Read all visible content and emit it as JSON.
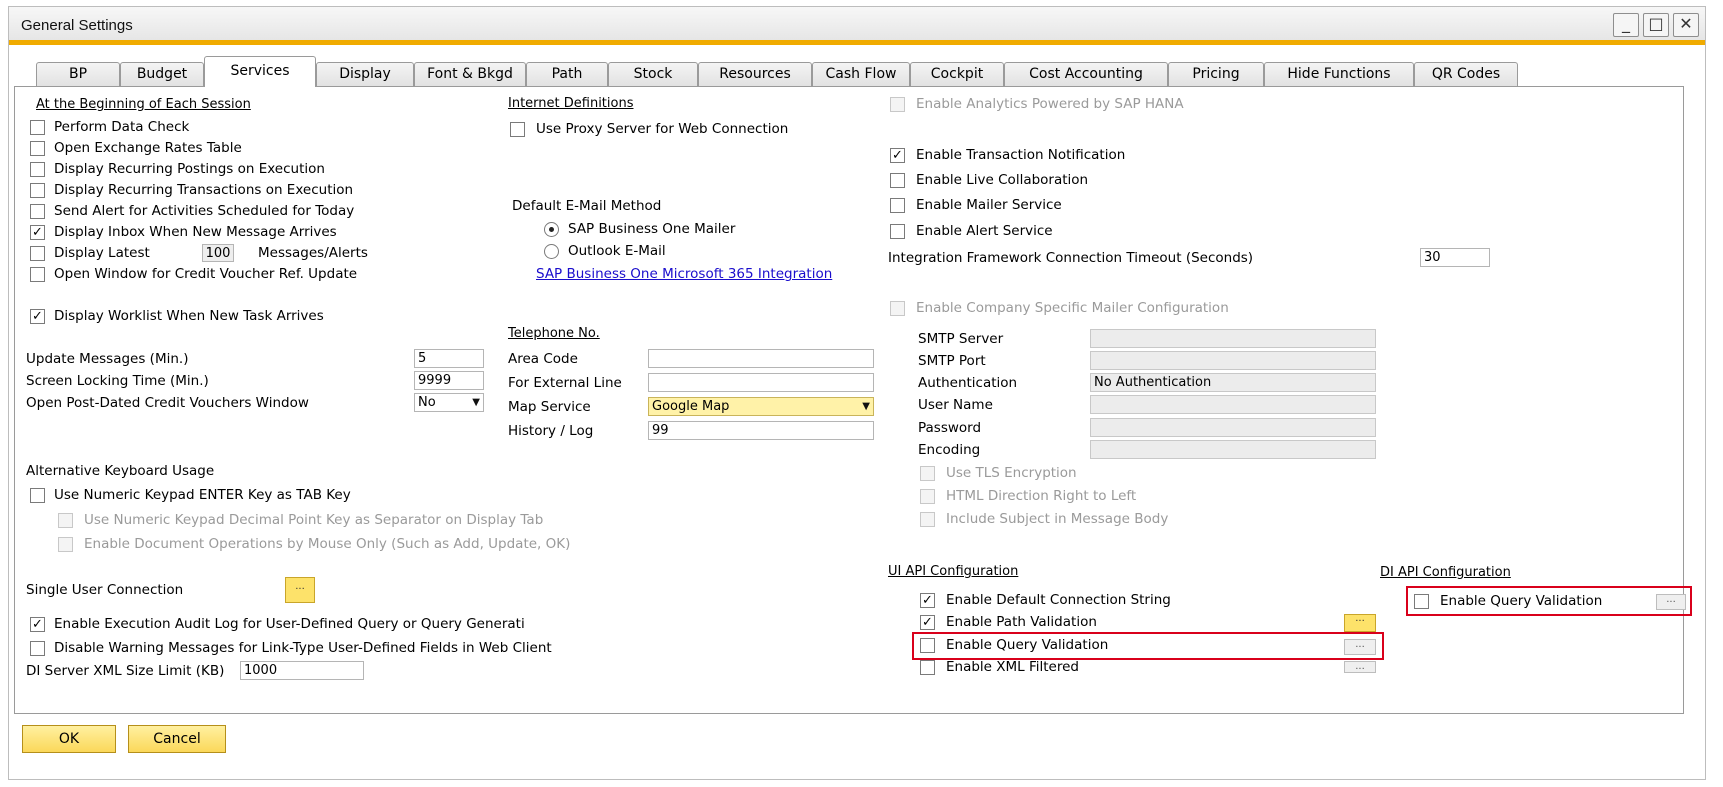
{
  "window": {
    "title": "General Settings",
    "controls": {
      "minimize": "_",
      "maximize": "□",
      "close": "✕"
    }
  },
  "tabs": [
    {
      "label": "BP"
    },
    {
      "label": "Budget"
    },
    {
      "label": "Services"
    },
    {
      "label": "Display"
    },
    {
      "label": "Font & Bkgd"
    },
    {
      "label": "Path"
    },
    {
      "label": "Stock"
    },
    {
      "label": "Resources"
    },
    {
      "label": "Cash Flow"
    },
    {
      "label": "Cockpit"
    },
    {
      "label": "Cost Accounting"
    },
    {
      "label": "Pricing"
    },
    {
      "label": "Hide Functions"
    },
    {
      "label": "QR Codes"
    }
  ],
  "session": {
    "header": "At the Beginning of Each Session",
    "items": [
      {
        "label": "Perform Data Check",
        "checked": false
      },
      {
        "label": "Open Exchange Rates Table",
        "checked": false
      },
      {
        "label": "Display Recurring Postings on Execution",
        "checked": false
      },
      {
        "label": "Display Recurring Transactions on Execution",
        "checked": false
      },
      {
        "label": "Send Alert for Activities Scheduled for Today",
        "checked": false
      },
      {
        "label": "Display Inbox When New Message Arrives",
        "checked": true
      }
    ],
    "latest_label": "Display Latest",
    "latest_value": "100",
    "latest_suffix": "Messages/Alerts",
    "credit_voucher": "Open Window for Credit Voucher Ref. Update",
    "worklist": "Display Worklist When New Task Arrives"
  },
  "fields": {
    "update_label": "Update Messages (Min.)",
    "update_value": "5",
    "lock_label": "Screen Locking Time (Min.)",
    "lock_value": "9999",
    "postdated_label": "Open Post-Dated Credit Vouchers Window",
    "postdated_value": "No"
  },
  "keyboard": {
    "header": "Alternative Keyboard Usage",
    "numeric_enter": "Use Numeric Keypad ENTER Key as TAB Key",
    "decimal": "Use Numeric Keypad Decimal Point Key as Separator on Display Tab",
    "mouse_only": "Enable Document Operations by Mouse Only (Such as Add, Update, OK)"
  },
  "bottom_left": {
    "single_user": "Single User Connection",
    "dots": "...",
    "audit_log": "Enable Execution Audit Log for User-Defined Query or Query Generati",
    "disable_warning": "Disable Warning Messages for Link-Type User-Defined Fields in Web Client",
    "xml_label": "DI Server XML Size Limit (KB)",
    "xml_value": "1000"
  },
  "internet": {
    "header": "Internet Definitions",
    "proxy": "Use Proxy Server for Web Connection"
  },
  "email": {
    "header": "Default E-Mail Method",
    "mailer": "SAP Business One Mailer",
    "outlook": "Outlook E-Mail",
    "link": "SAP Business One Microsoft 365 Integration"
  },
  "telephone": {
    "header": "Telephone No.",
    "area_code": "Area Code",
    "external_line": "For External Line",
    "map_service": "Map Service",
    "map_value": "Google Map",
    "history": "History / Log",
    "history_value": "99"
  },
  "right": {
    "hana": "Enable Analytics Powered by SAP HANA",
    "transaction": "Enable Transaction Notification",
    "live_collab": "Enable Live Collaboration",
    "mailer_service": "Enable Mailer Service",
    "alert_service": "Enable Alert Service",
    "timeout_label": "Integration Framework Connection Timeout (Seconds)",
    "timeout_value": "30",
    "company_mailer": "Enable Company Specific Mailer Configuration",
    "smtp_server": "SMTP Server",
    "smtp_port": "SMTP Port",
    "authentication": "Authentication",
    "auth_value": "No Authentication",
    "user_name": "User Name",
    "password": "Password",
    "encoding": "Encoding",
    "tls": "Use TLS Encryption",
    "html_dir": "HTML Direction Right to Left",
    "include_subject": "Include Subject in Message Body"
  },
  "ui_api": {
    "header": "UI API Configuration",
    "default_conn": "Enable Default Connection String",
    "path_validation": "Enable Path Validation",
    "query_validation": "Enable Query Validation",
    "xml_filtered": "Enable XML Filtered"
  },
  "di_api": {
    "header": "DI API Configuration",
    "query_validation": "Enable Query Validation"
  },
  "buttons": {
    "ok": "OK",
    "cancel": "Cancel"
  }
}
